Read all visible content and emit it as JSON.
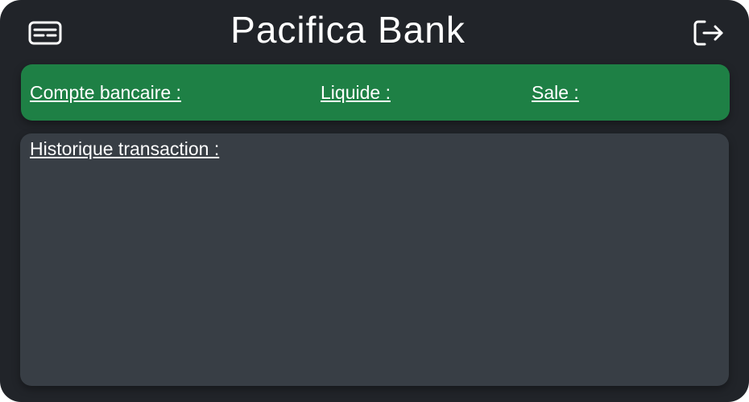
{
  "app": {
    "title": "Pacifica Bank"
  },
  "header": {
    "left_icon": "id-card-icon",
    "right_icon": "logout-icon"
  },
  "balances": {
    "bank_account_label": "Compte bancaire :",
    "cash_label": "Liquide :",
    "dirty_label": "Sale :"
  },
  "history": {
    "title": "Historique transaction :",
    "entries": []
  },
  "colors": {
    "background": "#212429",
    "balance_bar": "#1e8045",
    "panel": "#383e45",
    "text": "#ffffff"
  }
}
